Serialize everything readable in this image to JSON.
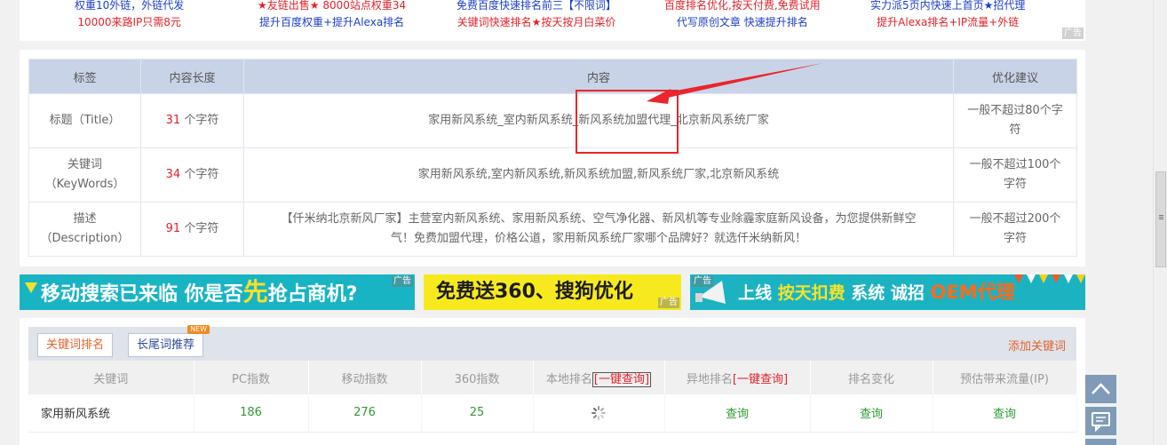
{
  "top_ads": {
    "col1": {
      "line1": "权重10外链，外链代发",
      "line2": "10000来路IP只需8元"
    },
    "col2": {
      "line1": "★友链出售★ 8000站点权重34",
      "line2": "提升百度权重+提升Alexa排名"
    },
    "col3": {
      "line1": "免费百度快速排名前三【不限词】",
      "line2": "关键词快速排名★按天按月白菜价"
    },
    "col4": {
      "line1": "百度排名优化,按天付费,免费试用",
      "line2": "代写原创文章  快速提升排名"
    },
    "col5": {
      "line1": "实力派5页内快速上首页★招代理",
      "line2": "提升Alexa排名+IP流量+外链"
    },
    "tag": "广告"
  },
  "tdk_table": {
    "headers": [
      "标签",
      "内容长度",
      "内容",
      "优化建议"
    ],
    "unit": "个字符",
    "rows": [
      {
        "label_line1": "标题（Title）",
        "label_line2": "",
        "length": "31",
        "content": "家用新风系统_室内新风系统_新风系统加盟代理_北京新风系统厂家",
        "advice_line1": "一般不超过80个字",
        "advice_line2": "符"
      },
      {
        "label_line1": "关键词",
        "label_line2": "（KeyWords）",
        "length": "34",
        "content": "家用新风系统,室内新风系统,新风系统加盟,新风系统厂家,北京新风系统",
        "advice_line1": "一般不超过100个",
        "advice_line2": "字符"
      },
      {
        "label_line1": "描述",
        "label_line2": "（Description）",
        "length": "91",
        "content_line1": "【仟米纳北京新风厂家】主营室内新风系统、家用新风系统、空气净化器、新风机等专业除霾家庭新风设备，为您提供新鲜空",
        "content_line2": "气！免费加盟代理，价格公道，家用新风系统厂家哪个品牌好？就选仟米纳新风！",
        "advice_line1": "一般不超过200个",
        "advice_line2": "字符"
      }
    ]
  },
  "banners": [
    {
      "text_a": "移动搜索已来临 你是否",
      "text_b": "先",
      "text_c": "抢占商机?",
      "tag": "广告",
      "bg": "#19b4c4"
    },
    {
      "text_a": "免费送360、搜狗优化",
      "tag": "广告",
      "bg": "#f6ea1e"
    },
    {
      "text_a": "上线 ",
      "text_b": "按天扣费",
      "text_c": " 系统 诚招 ",
      "text_d": "OEM代理",
      "tag": "广告",
      "bg": "#1bb3c2"
    }
  ],
  "keyword_panel": {
    "tab_active": "关键词排名",
    "tab_other": "长尾词推荐",
    "new_badge": "NEW",
    "add_link": "添加关键词",
    "columns": [
      "关键词",
      "PC指数",
      "移动指数",
      "360指数",
      "本地排名",
      "[一键查询]",
      "异地排名",
      "[一键查询]",
      "排名变化",
      "预估带来流量(IP)"
    ],
    "rows": [
      {
        "keyword": "家用新风系统",
        "pc": "186",
        "mobile": "276",
        "s360": "25",
        "remote": "查询",
        "change": "查询",
        "traffic": "查询"
      }
    ]
  },
  "colors": {
    "accent_red": "#e0222a",
    "header_blue": "#c9d3e8",
    "link_blue": "#1a3ec8",
    "green": "#2e9a30",
    "orange": "#e2632c"
  },
  "icons": [
    "loading-spinner-icon",
    "arrow-up-icon",
    "comment-icon",
    "red-arrow-annotation-icon"
  ]
}
